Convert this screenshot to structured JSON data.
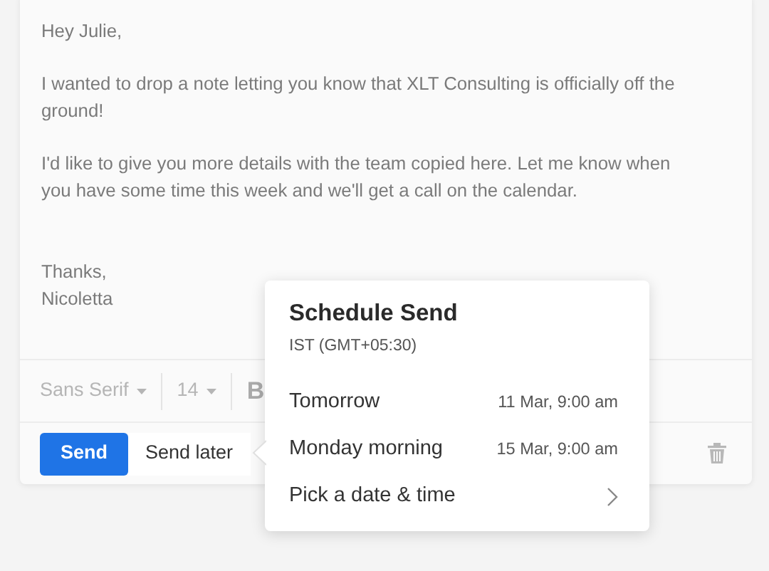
{
  "email": {
    "paragraphs": [
      "Hey Julie,",
      "I wanted to drop a note letting you know that XLT Consulting is officially off the ground!",
      "I'd like to give you more details with the team copied here. Let me know when you have some time this week and we'll get a call on the calendar."
    ],
    "signoff": [
      "Thanks,",
      "Nicoletta"
    ]
  },
  "toolbar": {
    "font": "Sans Serif",
    "size": "14",
    "bold": "B"
  },
  "actions": {
    "send": "Send",
    "send_later": "Send later"
  },
  "schedule_popover": {
    "title": "Schedule Send",
    "timezone": "IST (GMT+05:30)",
    "options": [
      {
        "kind": "preset",
        "label": "Tomorrow",
        "time": "11 Mar, 9:00 am"
      },
      {
        "kind": "preset",
        "label": "Monday morning",
        "time": "15 Mar, 9:00 am"
      },
      {
        "kind": "picker",
        "label": "Pick a date & time"
      }
    ]
  }
}
